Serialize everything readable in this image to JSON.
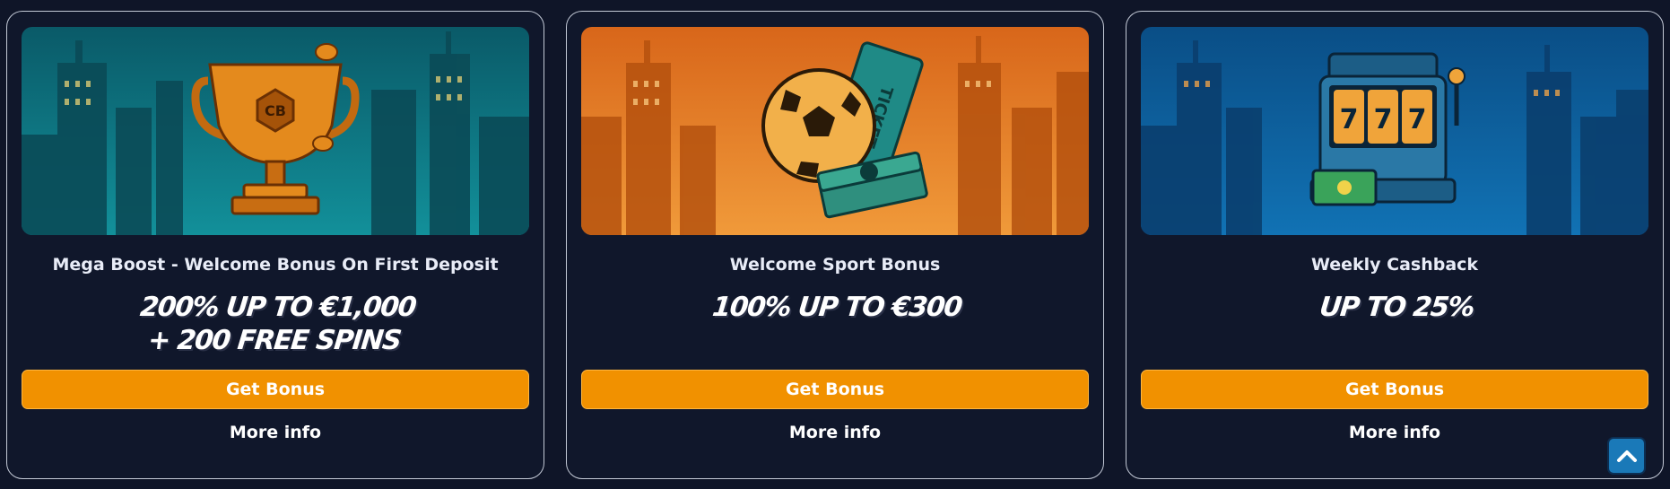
{
  "cards": [
    {
      "image_icon": "trophy-icon",
      "title": "Mega Boost - Welcome Bonus On First Deposit",
      "offer_line1": "200% UP TO €1,000",
      "offer_line2": "+ 200 FREE SPINS",
      "button_label": "Get Bonus",
      "more_info_label": "More info",
      "banner_color": "#0e7a86"
    },
    {
      "image_icon": "soccer-ball-ticket-icon",
      "title": "Welcome Sport Bonus",
      "offer_line1": "100% UP TO €300",
      "offer_line2": "",
      "button_label": "Get Bonus",
      "more_info_label": "More info",
      "banner_color": "#e57a1e"
    },
    {
      "image_icon": "slot-machine-icon",
      "title": "Weekly Cashback",
      "offer_line1": "UP TO 25%",
      "offer_line2": "",
      "button_label": "Get Bonus",
      "more_info_label": "More info",
      "banner_color": "#0e63a0"
    }
  ],
  "scroll_top": {
    "icon": "chevron-up-icon"
  },
  "colors": {
    "background": "#0f1528",
    "button": "#f19100",
    "scroll_button": "#1a79b8"
  }
}
